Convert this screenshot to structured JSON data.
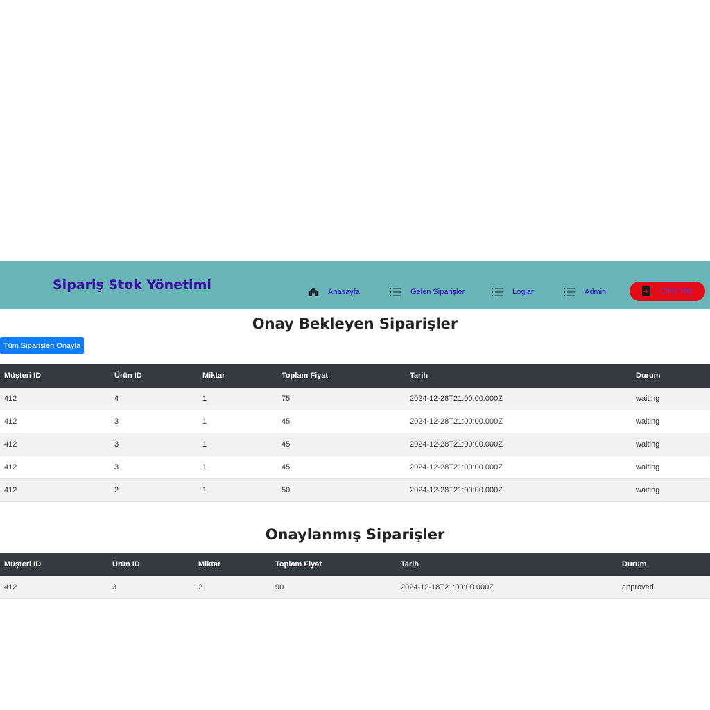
{
  "navbar": {
    "brand": "Sipariş Stok Yönetimi",
    "items": [
      {
        "label": "Anasayfa",
        "icon": "home-icon"
      },
      {
        "label": "Gelen Siparişler",
        "icon": "list-icon"
      },
      {
        "label": "Loglar",
        "icon": "list-icon"
      },
      {
        "label": "Admin",
        "icon": "list-icon"
      }
    ],
    "logout": {
      "label": "Çıkış Yap",
      "icon": "sign-out-icon"
    }
  },
  "colors": {
    "navbar": "#6ab5b8",
    "brand": "#3a0ca3",
    "logout": "#e30b17",
    "primary": "#0d7ef8",
    "table_header": "#343a40"
  },
  "pending": {
    "title": "Onay Bekleyen Siparişler",
    "approve_all_label": "Tüm Siparişleri Onayla",
    "columns": [
      "Müşteri ID",
      "Ürün ID",
      "Miktar",
      "Toplam Fiyat",
      "Tarih",
      "Durum"
    ],
    "rows": [
      [
        "412",
        "4",
        "1",
        "75",
        "2024-12-28T21:00:00.000Z",
        "waiting"
      ],
      [
        "412",
        "3",
        "1",
        "45",
        "2024-12-28T21:00:00.000Z",
        "waiting"
      ],
      [
        "412",
        "3",
        "1",
        "45",
        "2024-12-28T21:00:00.000Z",
        "waiting"
      ],
      [
        "412",
        "3",
        "1",
        "45",
        "2024-12-28T21:00:00.000Z",
        "waiting"
      ],
      [
        "412",
        "2",
        "1",
        "50",
        "2024-12-28T21:00:00.000Z",
        "waiting"
      ]
    ]
  },
  "approved": {
    "title": "Onaylanmış Siparişler",
    "columns": [
      "Müşteri ID",
      "Ürün ID",
      "Miktar",
      "Toplam Fiyat",
      "Tarih",
      "Durum"
    ],
    "rows": [
      [
        "412",
        "3",
        "2",
        "90",
        "2024-12-18T21:00:00.000Z",
        "approved"
      ]
    ]
  }
}
